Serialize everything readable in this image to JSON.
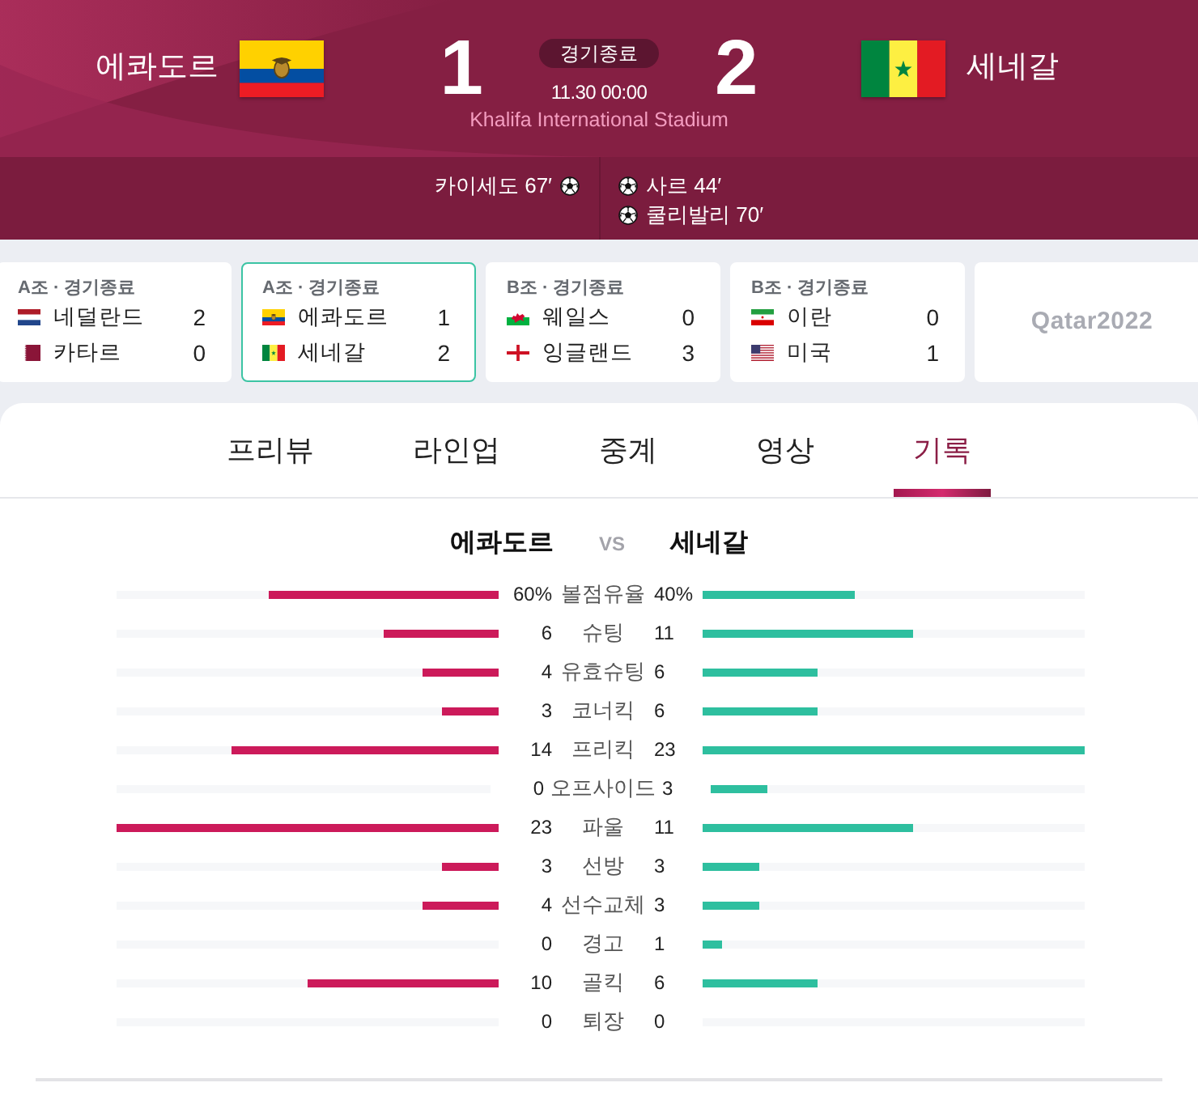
{
  "header": {
    "home": {
      "name": "에콰도르",
      "score": "1"
    },
    "away": {
      "name": "세네갈",
      "score": "2"
    },
    "status": "경기종료",
    "datetime": "11.30 00:00",
    "stadium": "Khalifa International Stadium"
  },
  "scorers": {
    "home": [
      "카이세도 67′"
    ],
    "away": [
      "사르 44′",
      "쿨리발리 70′"
    ]
  },
  "match_cards": [
    {
      "group": "A조 · 경기종료",
      "selected": false,
      "teams": [
        {
          "name": "네덜란드",
          "score": "2"
        },
        {
          "name": "카타르",
          "score": "0"
        }
      ]
    },
    {
      "group": "A조 · 경기종료",
      "selected": true,
      "teams": [
        {
          "name": "에콰도르",
          "score": "1"
        },
        {
          "name": "세네갈",
          "score": "2"
        }
      ]
    },
    {
      "group": "B조 · 경기종료",
      "selected": false,
      "teams": [
        {
          "name": "웨일스",
          "score": "0"
        },
        {
          "name": "잉글랜드",
          "score": "3"
        }
      ]
    },
    {
      "group": "B조 · 경기종료",
      "selected": false,
      "teams": [
        {
          "name": "이란",
          "score": "0"
        },
        {
          "name": "미국",
          "score": "1"
        }
      ]
    }
  ],
  "logo_card": {
    "text": "Qatar2022"
  },
  "tabs": [
    {
      "label": "프리뷰",
      "selected": false
    },
    {
      "label": "라인업",
      "selected": false
    },
    {
      "label": "중계",
      "selected": false
    },
    {
      "label": "영상",
      "selected": false
    },
    {
      "label": "기록",
      "selected": true
    }
  ],
  "stats": {
    "home_team": "에콰도르",
    "vs": "VS",
    "away_team": "세네갈",
    "rows": [
      {
        "label": "볼점유율",
        "home": {
          "value": "60%",
          "level": 0.6
        },
        "away": {
          "value": "40%",
          "level": 0.4
        }
      },
      {
        "label": "슈팅",
        "home": {
          "value": "6",
          "level": 0.3
        },
        "away": {
          "value": "11",
          "level": 0.55
        }
      },
      {
        "label": "유효슈팅",
        "home": {
          "value": "4",
          "level": 0.2
        },
        "away": {
          "value": "6",
          "level": 0.3
        }
      },
      {
        "label": "코너킥",
        "home": {
          "value": "3",
          "level": 0.15
        },
        "away": {
          "value": "6",
          "level": 0.3
        }
      },
      {
        "label": "프리킥",
        "home": {
          "value": "14",
          "level": 0.7
        },
        "away": {
          "value": "23",
          "level": 1
        }
      },
      {
        "label": "오프사이드",
        "home": {
          "value": "0"
        },
        "away": {
          "value": "3",
          "level": 0.15
        }
      },
      {
        "label": "파울",
        "home": {
          "value": "23",
          "level": 1
        },
        "away": {
          "value": "11",
          "level": 0.55
        }
      },
      {
        "label": "선방",
        "home": {
          "value": "3",
          "level": 0.15
        },
        "away": {
          "value": "3",
          "level": 0.15
        }
      },
      {
        "label": "선수교체",
        "home": {
          "value": "4",
          "level": 0.2
        },
        "away": {
          "value": "3",
          "level": 0.15
        }
      },
      {
        "label": "경고",
        "home": {
          "value": "0"
        },
        "away": {
          "value": "1",
          "level": 0.05
        }
      },
      {
        "label": "골킥",
        "home": {
          "value": "10",
          "level": 0.5
        },
        "away": {
          "value": "6",
          "level": 0.3
        }
      },
      {
        "label": "퇴장",
        "home": {
          "value": "0"
        },
        "away": {
          "value": "0"
        }
      }
    ]
  }
}
